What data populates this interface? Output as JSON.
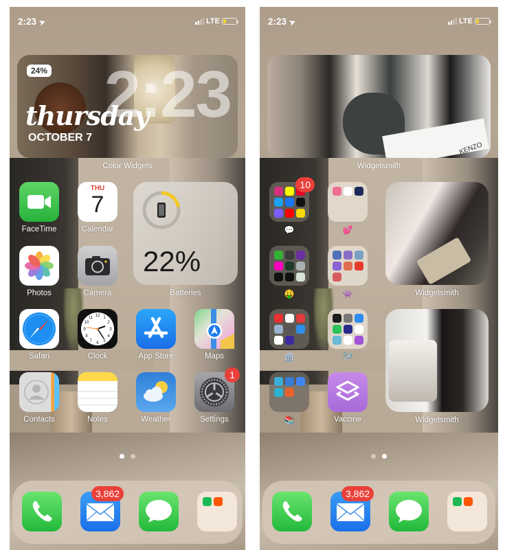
{
  "screens": [
    {
      "status": {
        "time": "2:23",
        "network": "LTE",
        "battery_level": 0.2
      },
      "top_widget": {
        "label": "Color Widgets",
        "battery_pill": "24%",
        "big_time": "2:23",
        "weekday": "thursday",
        "date": "OCTOBER 7"
      },
      "apps": [
        {
          "name": "FaceTime",
          "icon": "facetime-icon"
        },
        {
          "name": "Calendar",
          "icon": "calendar-icon",
          "dow": "THU",
          "day": "7"
        },
        {
          "name": "Photos",
          "icon": "photos-icon"
        },
        {
          "name": "Camera",
          "icon": "camera-icon"
        },
        {
          "name": "Safari",
          "icon": "safari-icon"
        },
        {
          "name": "Clock",
          "icon": "clock-icon"
        },
        {
          "name": "App Store",
          "icon": "app-store-icon"
        },
        {
          "name": "Maps",
          "icon": "maps-icon"
        },
        {
          "name": "Contacts",
          "icon": "contacts-icon"
        },
        {
          "name": "Notes",
          "icon": "notes-icon"
        },
        {
          "name": "Weather",
          "icon": "weather-icon"
        },
        {
          "name": "Settings",
          "icon": "settings-icon",
          "badge": "1"
        }
      ],
      "battery_widget": {
        "label": "Batteries",
        "value": "22%",
        "level": 0.22
      },
      "page_dots": {
        "count": 2,
        "active": 0
      }
    },
    {
      "status": {
        "time": "2:23",
        "network": "LTE",
        "battery_level": 0.2
      },
      "top_widget": {
        "label": "Widgetsmith",
        "photo_text": "KENZO"
      },
      "folders": [
        {
          "label": "💬",
          "badge": "10",
          "apps": [
            "instagram",
            "snapchat",
            "pinterest",
            "twitter",
            "facebook",
            "tiktok",
            "messenger",
            "youtube",
            "bereal"
          ],
          "colors": [
            "#d6317f",
            "#fffc00",
            "#e60023",
            "#1da1f2",
            "#1877f2",
            "#111111",
            "#7b5cff",
            "#ff0000",
            "#f5d90a"
          ]
        },
        {
          "label": "💕",
          "apps": [
            "app-pink",
            "app-heart",
            "app-navy"
          ],
          "colors": [
            "#ef6f93",
            "#ffffff",
            "#1e2a5a"
          ]
        },
        {
          "label": "🤑",
          "apps": [
            "td",
            "wallet",
            "yahoo",
            "lyft",
            "cash",
            "amazon",
            "s-app",
            "dark-app",
            "excel"
          ],
          "colors": [
            "#34b233",
            "#3b3b3b",
            "#6b2fa0",
            "#ff00bf",
            "#1f3a2a",
            "#a9b1b3",
            "#111111",
            "#111111",
            "#d9e4d6"
          ]
        },
        {
          "label": "👾",
          "apps": [
            "game1",
            "game2",
            "game3",
            "game4",
            "game5",
            "among-us",
            "game7"
          ],
          "colors": [
            "#4f6fb8",
            "#8b6cc7",
            "#7aa0c4",
            "#8a63d2",
            "#e06e4f",
            "#e63a2a",
            "#d65c5c"
          ]
        },
        {
          "label": "🏛️",
          "apps": [
            "doordash-alt",
            "d-app",
            "red-app",
            "photo-app",
            "camera-app",
            "blue-app",
            "capcut",
            "star-app"
          ],
          "colors": [
            "#e8302f",
            "#ffffff",
            "#e23b3b",
            "#9bb3d0",
            "#555555",
            "#2e8fe6",
            "#ffffff",
            "#3c2aa3"
          ]
        },
        {
          "label": "🪡",
          "apps": [
            "dark-app",
            "calc",
            "files",
            "green-app",
            "siri",
            "k-app",
            "photos-app",
            "home",
            "podcasts"
          ],
          "colors": [
            "#1c1c1c",
            "#777777",
            "#2c8ef0",
            "#2dc25a",
            "#2a2a8a",
            "#ffffff",
            "#68b9d8",
            "#ffffff",
            "#a254d8"
          ]
        },
        {
          "label": "📚",
          "apps": [
            "pencil",
            "calendar-app",
            "docs",
            "notes-app",
            "w-app"
          ],
          "colors": [
            "#3aaed8",
            "#3a7bd5",
            "#4285f4",
            "#2cb1d4",
            "#e8642c"
          ]
        }
      ],
      "photo_widgets": [
        {
          "label": "Widgetsmith"
        },
        {
          "label": "Widgetsmith"
        }
      ],
      "vaccine": {
        "name": "Vaccine",
        "icon": "shortcuts-icon"
      },
      "page_dots": {
        "count": 2,
        "active": 1
      }
    }
  ],
  "dock": [
    {
      "name": "Phone",
      "icon": "phone-icon"
    },
    {
      "name": "Mail",
      "icon": "mail-icon",
      "badge": "3,862"
    },
    {
      "name": "Messages",
      "icon": "messages-icon"
    },
    {
      "name": "Music Folder",
      "icon": "folder-icon",
      "apps": [
        "spotify",
        "soundcloud"
      ],
      "colors": [
        "#1db954",
        "#ff5500"
      ]
    }
  ]
}
